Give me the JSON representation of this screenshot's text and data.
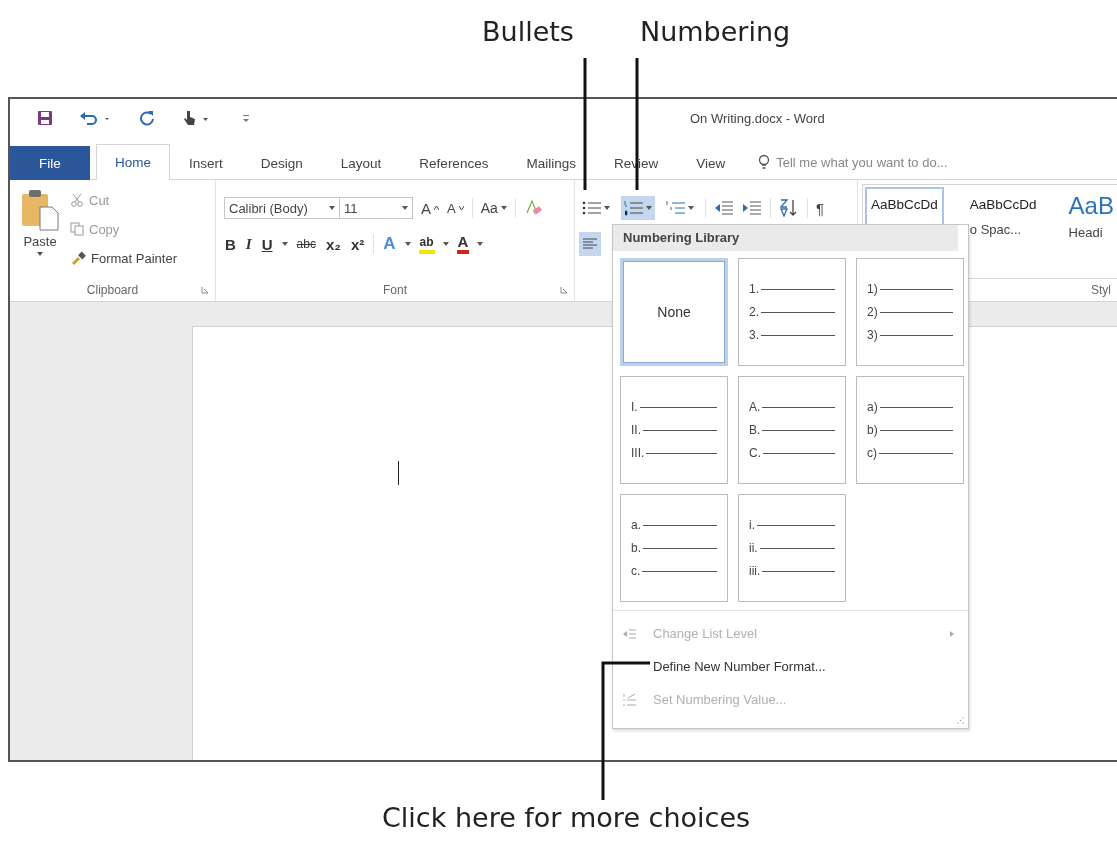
{
  "callouts": {
    "bullets": "Bullets",
    "numbering": "Numbering",
    "more": "Click here for more choices"
  },
  "window": {
    "title": "On Writing.docx - Word"
  },
  "tabs": [
    {
      "label": "File",
      "kind": "file",
      "selected": false
    },
    {
      "label": "Home",
      "kind": "tab",
      "selected": true
    },
    {
      "label": "Insert",
      "kind": "tab",
      "selected": false
    },
    {
      "label": "Design",
      "kind": "tab",
      "selected": false
    },
    {
      "label": "Layout",
      "kind": "tab",
      "selected": false
    },
    {
      "label": "References",
      "kind": "tab",
      "selected": false
    },
    {
      "label": "Mailings",
      "kind": "tab",
      "selected": false
    },
    {
      "label": "Review",
      "kind": "tab",
      "selected": false
    },
    {
      "label": "View",
      "kind": "tab",
      "selected": false
    }
  ],
  "tell_me": {
    "placeholder": "Tell me what you want to do..."
  },
  "clipboard": {
    "paste": "Paste",
    "cut": "Cut",
    "copy": "Copy",
    "format_painter": "Format Painter",
    "label": "Clipboard"
  },
  "font": {
    "name": "Calibri (Body)",
    "size": "11",
    "grow": "A",
    "shrink": "A",
    "change_case": "Aa",
    "label": "Font",
    "format_buttons": [
      {
        "kind": "bold",
        "text": "B"
      },
      {
        "kind": "italic",
        "text": "I"
      },
      {
        "kind": "underline",
        "text": "U"
      },
      {
        "kind": "strike",
        "text": "abc"
      },
      {
        "kind": "subscript",
        "text": "x₂"
      },
      {
        "kind": "superscript",
        "text": "x²"
      }
    ],
    "color_buttons": [
      {
        "kind": "effects",
        "text": "A",
        "color": "#4a8fd8"
      },
      {
        "kind": "highlight",
        "text": "ab",
        "color": "#f2e600"
      },
      {
        "kind": "fontcolor",
        "text": "A",
        "color": "#d62020"
      }
    ]
  },
  "paragraph": {
    "list_buttons": [
      {
        "kind": "bullets",
        "pressed": false
      },
      {
        "kind": "numbering",
        "pressed": true
      },
      {
        "kind": "multilevel",
        "pressed": false
      }
    ],
    "pilcrow": "¶",
    "align_left_pressed": true
  },
  "styles": {
    "items": [
      {
        "preview": "AaBbCcDd",
        "kind": "normal",
        "selected": true
      },
      {
        "preview": "AaBbCcDd",
        "name": "o Spac...",
        "kind": "normal",
        "selected": false
      },
      {
        "preview": "AaB",
        "name": "Headi",
        "kind": "heading",
        "selected": false
      }
    ],
    "label": "Styl"
  },
  "menu": {
    "title": "Numbering Library",
    "tiles": [
      {
        "kind": "none",
        "label": "None",
        "selected": true
      },
      {
        "kind": "list",
        "markers": [
          "1.",
          "2.",
          "3."
        ],
        "selected": false
      },
      {
        "kind": "list",
        "markers": [
          "1)",
          "2)",
          "3)"
        ],
        "selected": false
      },
      {
        "kind": "list",
        "markers": [
          "I.",
          "II.",
          "III."
        ],
        "selected": false
      },
      {
        "kind": "list",
        "markers": [
          "A.",
          "B.",
          "C."
        ],
        "selected": false
      },
      {
        "kind": "list",
        "markers": [
          "a)",
          "b)",
          "c)"
        ],
        "selected": false
      },
      {
        "kind": "list",
        "markers": [
          "a.",
          "b.",
          "c."
        ],
        "selected": false
      },
      {
        "kind": "list",
        "markers": [
          "i.",
          "ii.",
          "iii."
        ],
        "selected": false
      }
    ],
    "items": [
      {
        "label": "Change List Level",
        "kind": "level",
        "disabled": true,
        "submenu": true
      },
      {
        "label": "Define New Number Format...",
        "kind": "define",
        "disabled": false,
        "submenu": false
      },
      {
        "label": "Set Numbering Value...",
        "kind": "value",
        "disabled": true,
        "submenu": false
      }
    ]
  }
}
